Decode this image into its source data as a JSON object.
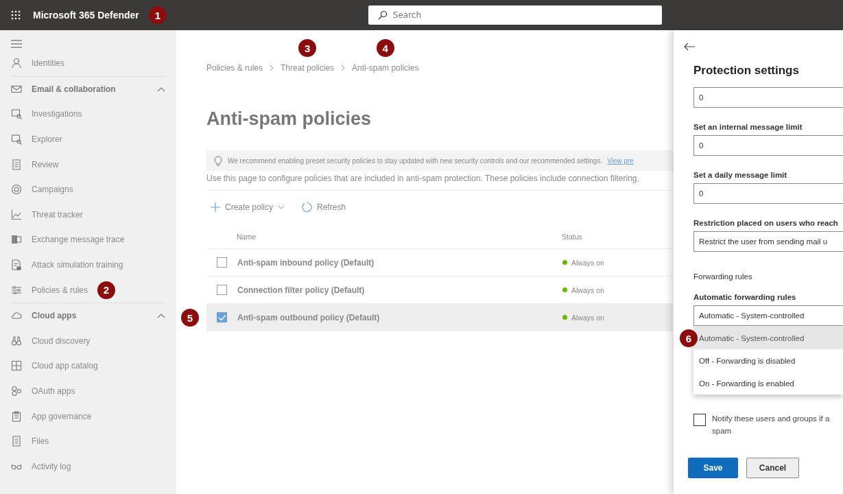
{
  "topbar": {
    "title": "Microsoft 365 Defender",
    "search": {
      "placeholder": "Search"
    }
  },
  "callouts": [
    "1",
    "2",
    "3",
    "4",
    "5",
    "6"
  ],
  "sidebar": {
    "items": [
      {
        "label": "Identities",
        "kind": "item"
      },
      {
        "label": "Email & collaboration",
        "kind": "section",
        "expanded": true
      },
      {
        "label": "Investigations",
        "kind": "item"
      },
      {
        "label": "Explorer",
        "kind": "item"
      },
      {
        "label": "Review",
        "kind": "item"
      },
      {
        "label": "Campaigns",
        "kind": "item"
      },
      {
        "label": "Threat tracker",
        "kind": "item"
      },
      {
        "label": "Exchange message trace",
        "kind": "item"
      },
      {
        "label": "Attack simulation training",
        "kind": "item"
      },
      {
        "label": "Policies & rules",
        "kind": "item"
      },
      {
        "label": "Cloud apps",
        "kind": "section",
        "expanded": true
      },
      {
        "label": "Cloud discovery",
        "kind": "item"
      },
      {
        "label": "Cloud app catalog",
        "kind": "item"
      },
      {
        "label": "OAuth apps",
        "kind": "item"
      },
      {
        "label": "App governance",
        "kind": "item"
      },
      {
        "label": "Files",
        "kind": "item"
      },
      {
        "label": "Activity log",
        "kind": "item"
      }
    ]
  },
  "breadcrumb": [
    {
      "label": "Policies & rules"
    },
    {
      "label": "Threat policies"
    },
    {
      "label": "Anti-spam policies"
    }
  ],
  "page_title": "Anti-spam policies",
  "banner": {
    "text": "We recommend enabling preset security policies to stay updated with new security controls and our recommended settings.",
    "link": "View pre"
  },
  "description": "Use this page to configure policies that are included in anti-spam protection. These policies include connection filtering,",
  "toolbar": [
    {
      "label": "Create policy",
      "kind": "create"
    },
    {
      "label": "Refresh",
      "kind": "refresh"
    }
  ],
  "table": {
    "columns": [
      "Name",
      "Status"
    ],
    "rows": [
      {
        "name": "Anti-spam inbound policy (Default)",
        "status": "Always on",
        "selected": false
      },
      {
        "name": "Connection filter policy (Default)",
        "status": "Always on",
        "selected": false
      },
      {
        "name": "Anti-spam outbound policy (Default)",
        "status": "Always on",
        "selected": true
      }
    ]
  },
  "panel": {
    "title": "Protection settings",
    "fields": [
      {
        "value": "0"
      },
      {
        "label": "Set an internal message limit",
        "value": "0"
      },
      {
        "label": "Set a daily message limit",
        "value": "0"
      },
      {
        "label": "Restriction placed on users who reach",
        "value": "Restrict the user from sending mail u"
      }
    ],
    "section": "Forwarding rules",
    "forwarding": {
      "label": "Automatic forwarding rules",
      "value": "Automatic - System-controlled",
      "options": [
        {
          "label": "Automatic - System-controlled",
          "selected": true
        },
        {
          "label": "Off - Forwarding is disabled",
          "selected": false
        },
        {
          "label": "On - Forwarding is enabled",
          "selected": false
        }
      ]
    },
    "notify": {
      "label": "Notify these users and groups if a",
      "label2": "spam",
      "checked": false
    },
    "buttons": [
      {
        "label": "Save",
        "kind": "primary"
      },
      {
        "label": "Cancel",
        "kind": "default"
      }
    ]
  }
}
